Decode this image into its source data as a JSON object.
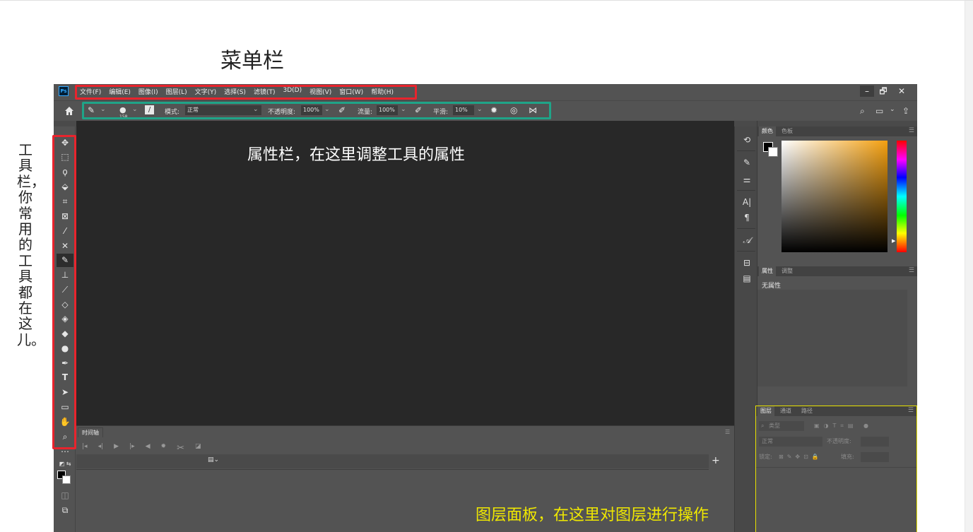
{
  "annotations": {
    "menubar_label": "菜单栏",
    "toolbar_label": "工具栏，你常用的工具都在这儿。",
    "optionsbar_label": "属性栏，在这里调整工具的属性",
    "layers_label": "图层面板，在这里对图层进行操作"
  },
  "app": {
    "logo": "Ps",
    "menu": [
      "文件(F)",
      "编辑(E)",
      "图像(I)",
      "图层(L)",
      "文字(Y)",
      "选择(S)",
      "滤镜(T)",
      "3D(D)",
      "视图(V)",
      "窗口(W)",
      "帮助(H)"
    ],
    "window_controls": {
      "minimize": "–",
      "restore": "🗗",
      "close": "✕"
    }
  },
  "options_bar": {
    "brush_size": "158",
    "mode_label": "模式:",
    "mode_value": "正常",
    "opacity_label": "不透明度:",
    "opacity_value": "100%",
    "flow_label": "流量:",
    "flow_value": "100%",
    "smoothing_label": "平滑:",
    "smoothing_value": "10%"
  },
  "timeline": {
    "tab": "时间轴"
  },
  "panels": {
    "color_tabs": [
      "颜色",
      "色板"
    ],
    "properties_tabs": [
      "属性",
      "调整"
    ],
    "properties_empty": "无属性",
    "layers_tabs": [
      "图层",
      "通道",
      "路径"
    ],
    "layers_filter": "类型",
    "blend_mode": "正常",
    "opacity_label": "不透明度:",
    "lock_label": "锁定:",
    "fill_label": "填充:"
  },
  "colors": {
    "app_bg": "#535353",
    "canvas_bg": "#282828",
    "highlight_menu": "#e8242d",
    "highlight_options": "#1fa488",
    "highlight_layers": "#e8e200"
  }
}
